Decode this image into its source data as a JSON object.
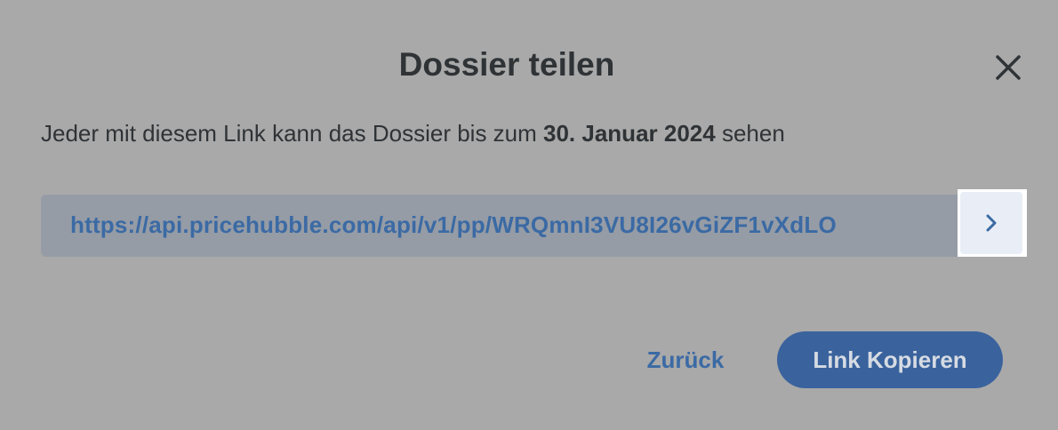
{
  "dialog": {
    "title": "Dossier teilen",
    "description_prefix": "Jeder mit diesem Link kann das Dossier bis zum ",
    "description_date": "30. Januar 2024",
    "description_suffix": " sehen",
    "link_url": "https://api.pricehubble.com/api/v1/pp/WRQmnI3VU8I26vGiZF1vXdLO",
    "back_label": "Zurück",
    "copy_label": "Link Kopieren"
  },
  "icons": {
    "close": "close-icon",
    "link_arrow": "chevron-right-icon"
  },
  "colors": {
    "overlay": "#a9a9a9",
    "text_dark": "#2f3336",
    "link_blue": "#3b6aa4",
    "link_box_bg": "#959ca6",
    "primary_button": "#3a639d"
  }
}
